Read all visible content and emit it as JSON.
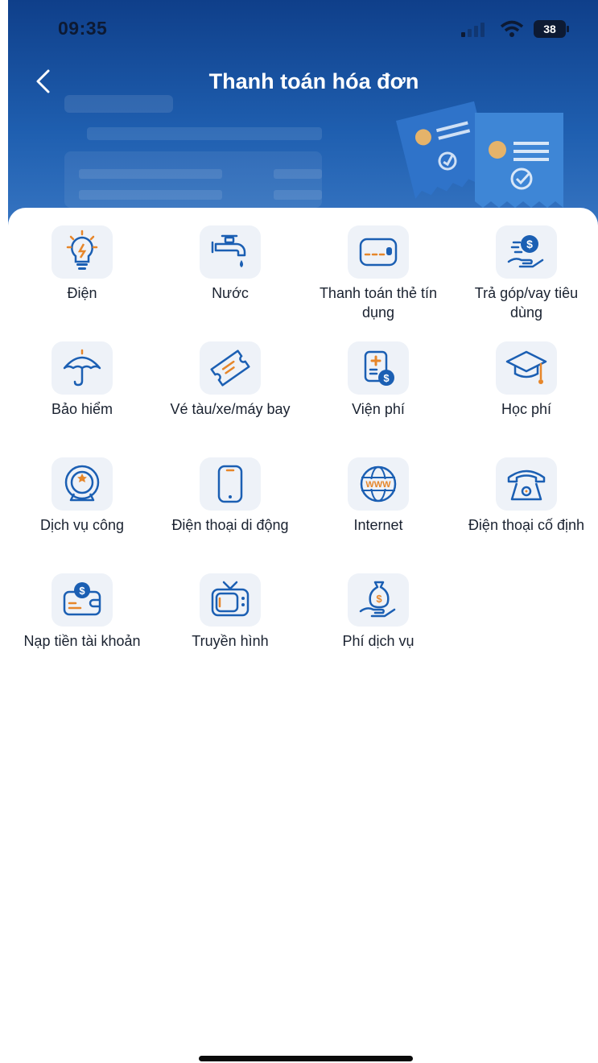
{
  "status_bar": {
    "time": "09:35",
    "battery": "38"
  },
  "header": {
    "title": "Thanh toán hóa đơn"
  },
  "services": [
    {
      "label": "Điện",
      "icon": "lightbulb-icon"
    },
    {
      "label": "Nước",
      "icon": "water-tap-icon"
    },
    {
      "label": "Thanh toán thẻ tín dụng",
      "icon": "credit-card-icon"
    },
    {
      "label": "Trả góp/vay tiêu dùng",
      "icon": "loan-hand-icon"
    },
    {
      "label": "Bảo hiểm",
      "icon": "umbrella-icon"
    },
    {
      "label": "Vé tàu/xe/máy bay",
      "icon": "ticket-icon"
    },
    {
      "label": "Viện phí",
      "icon": "hospital-bill-icon"
    },
    {
      "label": "Học phí",
      "icon": "graduation-cap-icon"
    },
    {
      "label": "Dịch vụ công",
      "icon": "public-service-icon"
    },
    {
      "label": "Điện thoại di động",
      "icon": "mobile-phone-icon"
    },
    {
      "label": "Internet",
      "icon": "globe-www-icon"
    },
    {
      "label": "Điện thoại cố định",
      "icon": "landline-phone-icon"
    },
    {
      "label": "Nạp tiền tài khoản",
      "icon": "wallet-topup-icon"
    },
    {
      "label": "Truyền hình",
      "icon": "tv-icon"
    },
    {
      "label": "Phí dịch vụ",
      "icon": "money-bag-hand-icon"
    }
  ],
  "colors": {
    "header_dark": "#0f3f8a",
    "header_light": "#3a78c4",
    "icon_blue": "#1b5fb3",
    "icon_accent": "#e6862a",
    "icon_tile_bg": "#eef2f8"
  }
}
